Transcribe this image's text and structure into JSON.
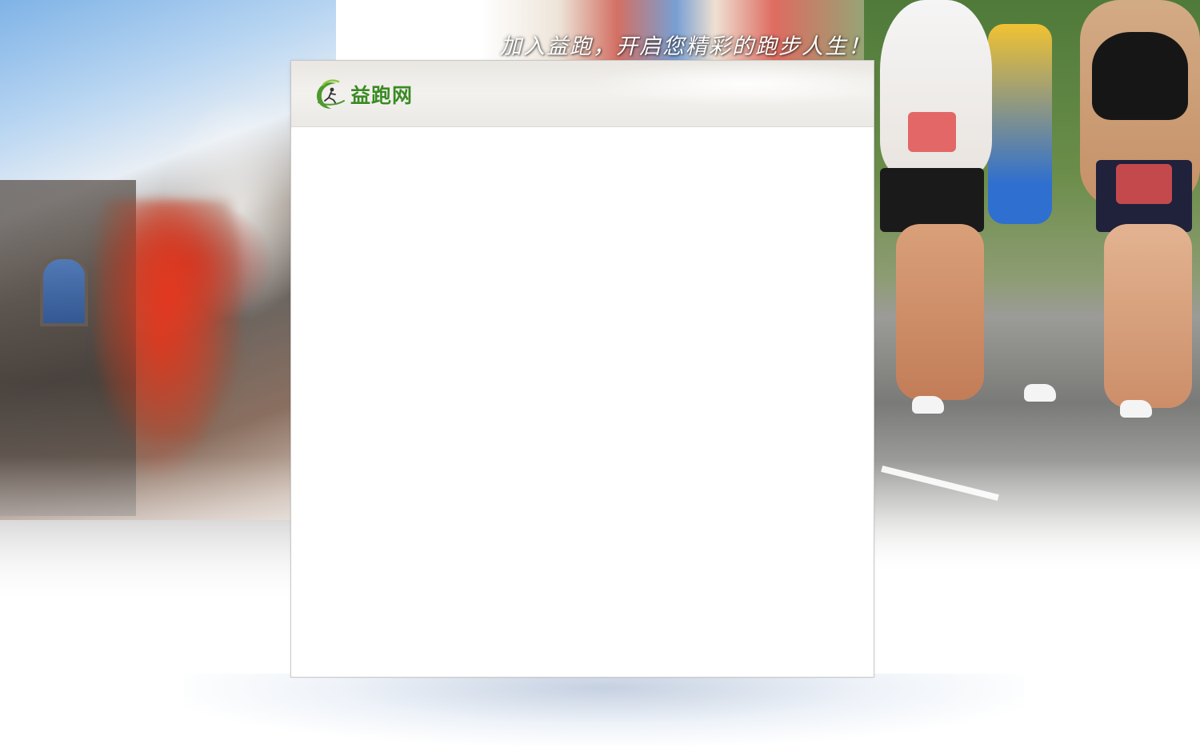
{
  "slogan": "加入益跑，开启您精彩的跑步人生！",
  "logo": {
    "text": "益跑网",
    "icon": "runner-swoosh-logo-icon"
  },
  "colors": {
    "brand_green": "#3a8a24",
    "panel_background": "#ffffff",
    "header_background": "#eeece8"
  }
}
